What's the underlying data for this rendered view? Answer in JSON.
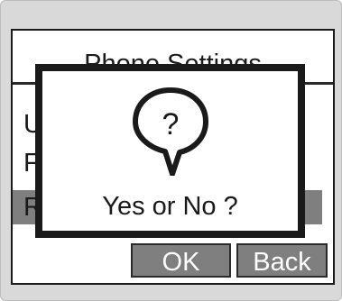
{
  "screen": {
    "title": "Phone Settings",
    "menu_items": [
      {
        "label": "U"
      },
      {
        "label": "FT"
      },
      {
        "label": "R"
      }
    ]
  },
  "dialog": {
    "icon": "question-bubble-icon",
    "icon_glyph": "?",
    "message": "Yes or No ?"
  },
  "softkeys": {
    "ok_label": "OK",
    "back_label": "Back"
  },
  "colors": {
    "highlight": "#7f7f7f",
    "border": "#1a1a1a",
    "device_bezel": "#d9d9d9"
  }
}
